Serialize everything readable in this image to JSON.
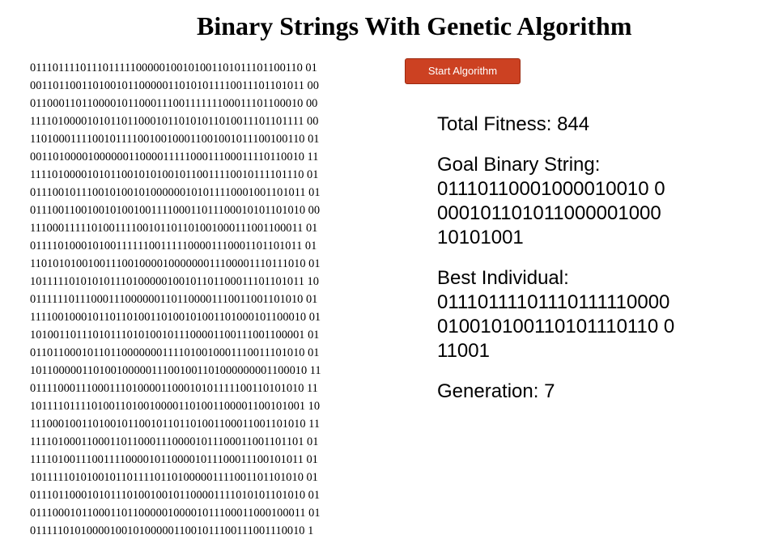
{
  "page": {
    "title": "Binary Strings With Genetic Algorithm"
  },
  "controls": {
    "start_label": "Start Algorithm",
    "start_color": "#cc4122"
  },
  "stats": {
    "total_fitness_label": "Total Fitness:",
    "total_fitness_value": "844",
    "goal_label": "Goal Binary String:",
    "goal_lines": [
      "01110110001000010010 0",
      "000101101011000001000",
      "10101001"
    ],
    "best_label": "Best Individual:",
    "best_lines": [
      "01110111101110111110000",
      "010010100110101110110 0",
      "11001"
    ],
    "generation_label": "Generation:",
    "generation_value": "7"
  },
  "population": [
    "011101111011101111100000100101001101011101100110 01",
    "001101100110100101100000110101011110011101101011 00",
    "011000110110000101100011100111111100011101100010 00",
    "111101000010101101100010110101011010011101101111 00",
    "110100011110010111100100100011001001011100100110 01",
    "001101000010000001100001111100011100011110110010 11",
    "111101000010101100101010010110011110010111101110 01",
    "011100101110010100101000000101011110001001101011 01",
    "011100110010010100100111100011011100010101101010 00",
    "111000111110100111100101101101001000111001100011 01",
    "011110100010100111111001111100001110001101101011 01",
    "110101010010011100100001000000011100001110111010 01",
    "101111101010101110100000100101101100011101101011 10",
    "011111101110001110000001101100001110011001101010 01",
    "111100100010110110100110100101001101000101100010 01",
    "101001101110101110101001011100001100111001100001 01",
    "011011000101101100000001111010010001110011101010 01",
    "101100000110100100000111001001101000000001100010 11",
    "011110001110001110100001100010101111100110101010 11",
    "101111011110100110100100001101001100001100101001 10",
    "111000100110100101100101101101001100011001101010 11",
    "111101000110001101100011100001011100011001101101 01",
    "111101001110011110000101100001011100011100101011 01",
    "101111101010010110111101101000001111001101101010 01",
    "011101100010101110100100101100001111010101101010 01",
    "011100010110001101100000100001011100011000100011 01",
    "011111010100001001010000011001011100111001110010 1"
  ]
}
